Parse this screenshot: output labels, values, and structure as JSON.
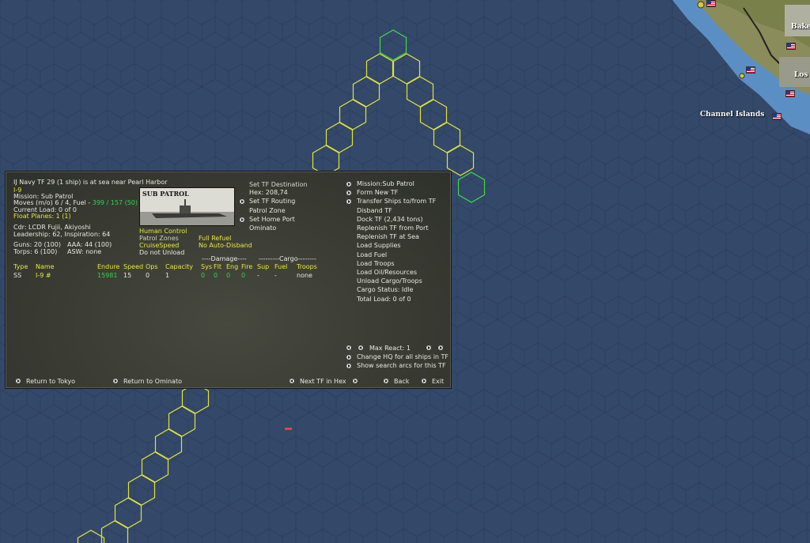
{
  "map": {
    "place_labels": [
      "Bake",
      "Los",
      "Channel Islands"
    ]
  },
  "panel": {
    "left": {
      "title": "IJ Navy TF 29 (1 ship) is at sea near Pearl Harbor",
      "ship": "I-9",
      "mission": "Mission: Sub Patrol",
      "moves": "Moves (m/o) 6 / 4, Fuel - ",
      "fuel": "399 / 157 (50)",
      "current_load": "Current Load: 0 of 0",
      "float_planes": "Float Planes: 1 (1)",
      "cdr": "Cdr: LCDR Fujii, Akiyoshi",
      "leadership": "Leadership: 62, Inspiration: 64",
      "guns": "Guns: 20 (100)",
      "aaa": "AAA: 44 (100)",
      "torps": "Torps: 6 (100)",
      "asw": "ASW: none"
    },
    "photo_caption": "SUB PATROL",
    "orders": {
      "human_control": "Human Control",
      "patrol_zones": "Patrol Zones",
      "cruise_speed": "CruiseSpeed",
      "do_not_unload": "Do not Unload",
      "full_refuel": "Full Refuel",
      "no_auto_disband": "No Auto-Disband"
    },
    "mid_actions": {
      "set_dest": "Set TF Destination",
      "hex": "Hex: 208,74",
      "set_routing": "Set TF Routing",
      "patrol_zone": "Patrol Zone",
      "set_home": "Set Home Port",
      "home_port": "Ominato"
    },
    "table": {
      "damage_header": "----Damage----",
      "cargo_header": "---------Cargo--------",
      "headers": [
        "Type",
        "Name",
        "Endure",
        "Speed",
        "Ops",
        "Capacity",
        "Sys",
        "Flt",
        "Eng",
        "Fire",
        "Sup",
        "Fuel",
        "Troops"
      ],
      "row": [
        "SS",
        "I-9 #",
        "15981",
        "15",
        "0",
        "1",
        "0",
        "0",
        "0",
        "0",
        "-",
        "-",
        "none"
      ]
    },
    "right_actions": [
      "Mission:Sub Patrol",
      "Form New TF",
      "Transfer Ships to/from TF",
      "Disband TF",
      "Dock TF (2,434 tons)",
      "Replenish TF from Port",
      "Replenish TF at Sea",
      "Load Supplies",
      "Load Fuel",
      "Load Troops",
      "Load Oil/Resources",
      "Unload Cargo/Troops",
      "Cargo Status: Idle",
      "Total Load: 0 of 0"
    ],
    "max_react": "Max React:  1",
    "change_hq": "Change HQ for all ships in TF",
    "show_arcs": "Show search arcs for this TF",
    "bottom": {
      "return_tokyo": "Return to Tokyo",
      "return_ominato": "Return to Ominato",
      "next_tf": "Next TF in Hex",
      "back": "Back",
      "exit": "Exit"
    }
  },
  "colors": {
    "ocean": "#34486a",
    "hex_line": "#2a3c5a",
    "patrol_hex": "#e2e23a",
    "selected_hex": "#3ed84a",
    "coast": "#5a86b8",
    "land": "#8a8a5a"
  }
}
